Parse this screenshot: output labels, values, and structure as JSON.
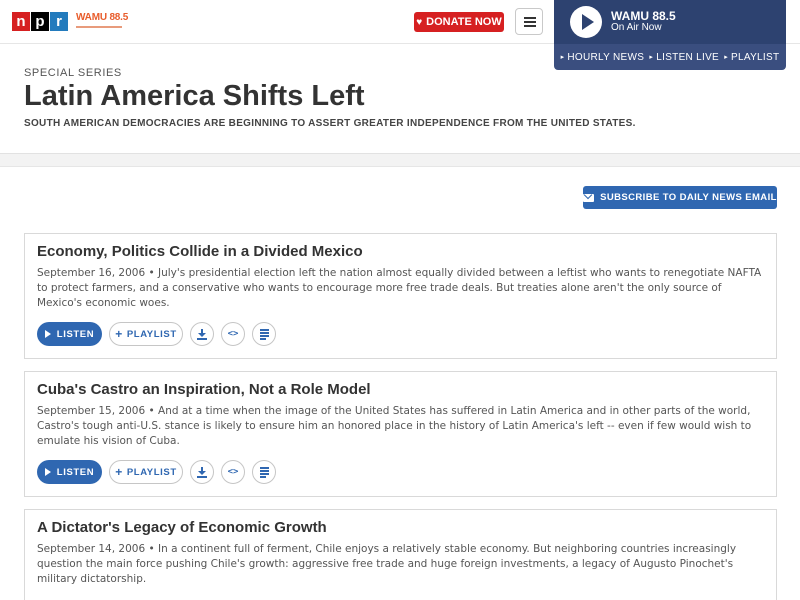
{
  "header": {
    "npr_letters": [
      "n",
      "p",
      "r"
    ],
    "station_logo_text": "WAMU 88.5",
    "donate_label": "DONATE NOW"
  },
  "player": {
    "station": "WAMU 88.5",
    "status": "On Air Now",
    "links": [
      "HOURLY NEWS",
      "LISTEN LIVE",
      "PLAYLIST"
    ]
  },
  "page": {
    "series_label": "SPECIAL SERIES",
    "title": "Latin America Shifts Left",
    "subtitle": "SOUTH AMERICAN DEMOCRACIES ARE BEGINNING TO ASSERT GREATER INDEPENDENCE FROM THE UNITED STATES."
  },
  "subscribe": {
    "label": "SUBSCRIBE TO DAILY NEWS EMAIL"
  },
  "actions": {
    "listen": "LISTEN",
    "playlist": "PLAYLIST",
    "embed_glyph": "<>"
  },
  "stories": [
    {
      "title": "Economy, Politics Collide in a Divided Mexico",
      "date": "September 16, 2006",
      "teaser": "July's presidential election left the nation almost equally divided between a leftist who wants to renegotiate NAFTA to protect farmers, and a conservative who wants to encourage more free trade deals. But treaties alone aren't the only source of Mexico's economic woes."
    },
    {
      "title": "Cuba's Castro an Inspiration, Not a Role Model",
      "date": "September 15, 2006",
      "teaser": "And at a time when the image of the United States has suffered in Latin America and in other parts of the world, Castro's tough anti-U.S. stance is likely to ensure him an honored place in the history of Latin America's left -- even if few would wish to emulate his vision of Cuba."
    },
    {
      "title": "A Dictator's Legacy of Economic Growth",
      "date": "September 14, 2006",
      "teaser": "In a continent full of ferment, Chile enjoys a relatively stable economy. But neighboring countries increasingly question the main force pushing Chile's growth: aggressive free trade and huge foreign investments, a legacy of Augusto Pinochet's military dictatorship."
    }
  ],
  "colors": {
    "npr_red": "#d62021",
    "npr_blue": "#237bbd",
    "player_bg": "#2d4270",
    "action_blue": "#2f67b1"
  }
}
